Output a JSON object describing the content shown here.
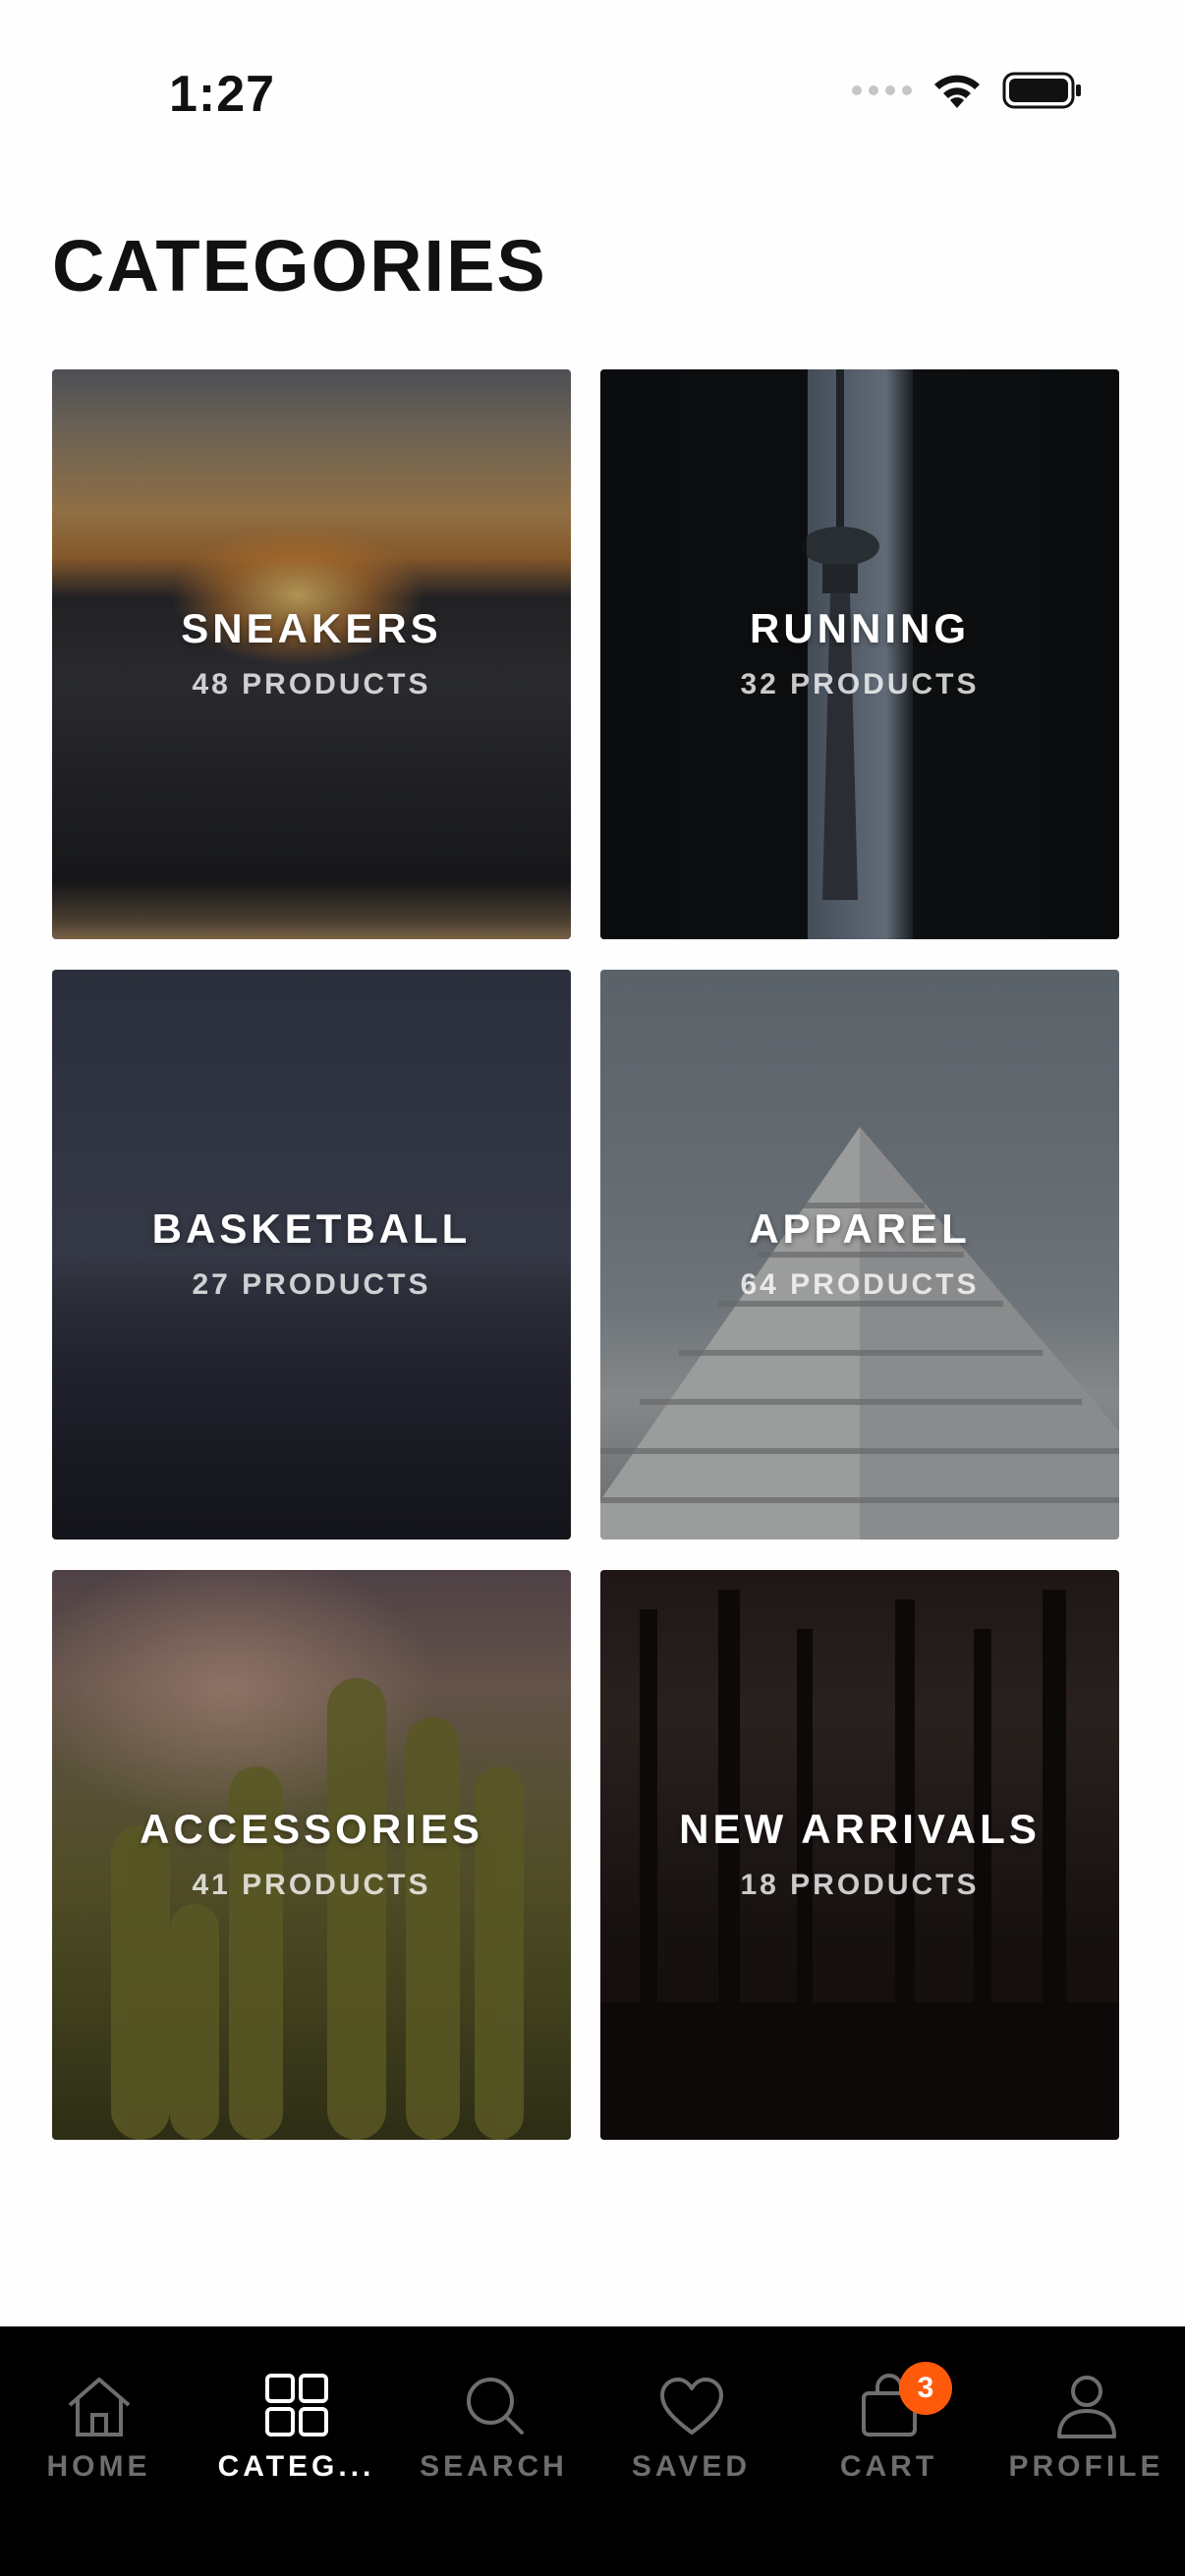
{
  "status_bar": {
    "time": "1:27",
    "icons": [
      "cellular-signal-icon",
      "wifi-icon",
      "battery-icon"
    ]
  },
  "page": {
    "title": "CATEGORIES"
  },
  "categories": [
    {
      "name": "SNEAKERS",
      "count": "48 PRODUCTS"
    },
    {
      "name": "RUNNING",
      "count": "32 PRODUCTS"
    },
    {
      "name": "BASKETBALL",
      "count": "27 PRODUCTS"
    },
    {
      "name": "APPAREL",
      "count": "64 PRODUCTS"
    },
    {
      "name": "ACCESSORIES",
      "count": "41 PRODUCTS"
    },
    {
      "name": "NEW ARRIVALS",
      "count": "18 PRODUCTS"
    }
  ],
  "tab_bar": {
    "active": "CATEG...",
    "tabs": [
      {
        "label": "HOME",
        "icon": "home-icon"
      },
      {
        "label": "CATEG...",
        "icon": "grid-icon"
      },
      {
        "label": "SEARCH",
        "icon": "search-icon"
      },
      {
        "label": "SAVED",
        "icon": "heart-icon"
      },
      {
        "label": "CART",
        "icon": "bag-icon",
        "badge": "3"
      },
      {
        "label": "PROFILE",
        "icon": "person-icon"
      }
    ]
  },
  "colors": {
    "accent_badge": "#ff5a0a",
    "tab_bar_bg": "#000000",
    "tab_inactive": "#6e6e6e",
    "tab_active": "#ffffff"
  }
}
